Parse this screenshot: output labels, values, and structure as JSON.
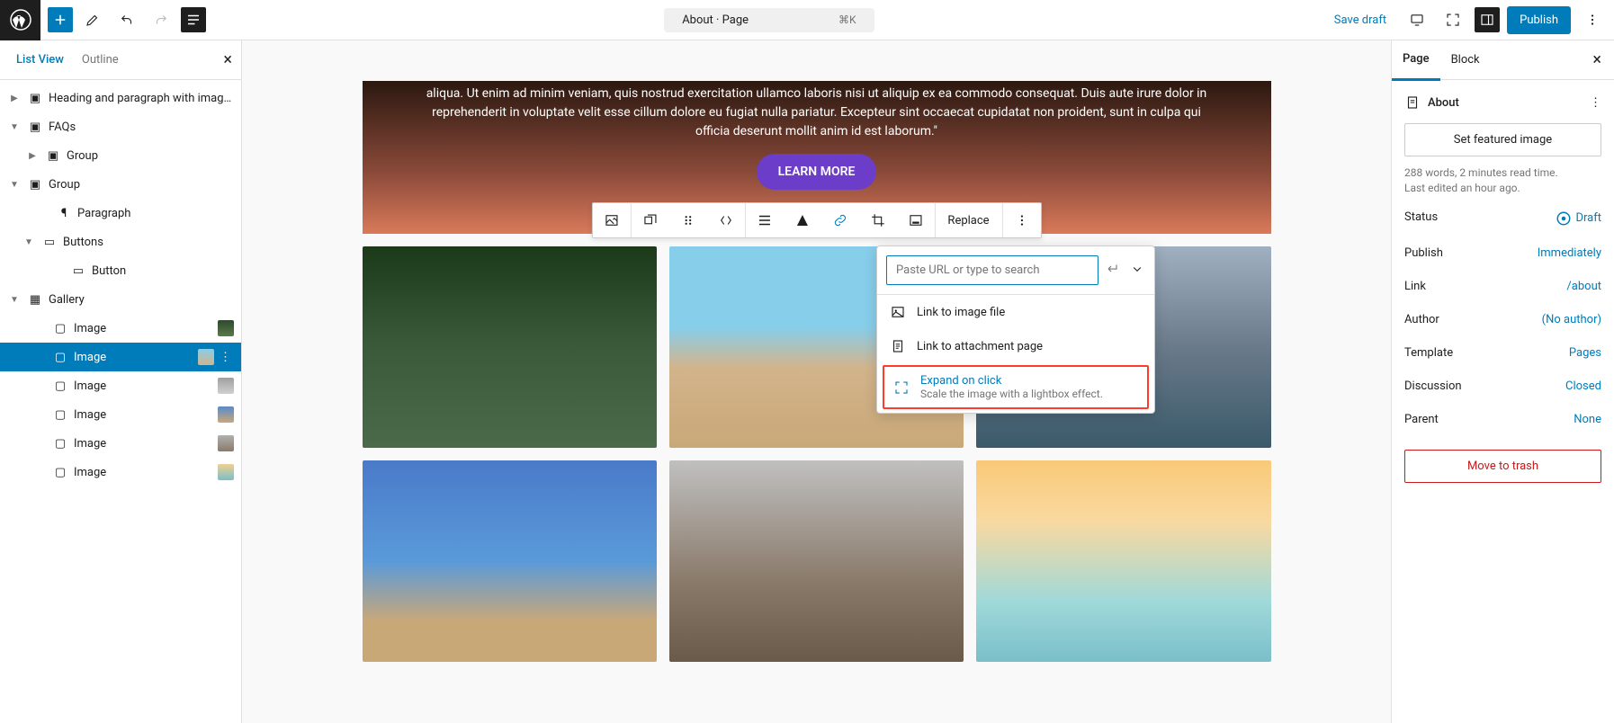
{
  "topbar": {
    "doc_title": "About · Page",
    "shortcut": "⌘K",
    "save_draft": "Save draft",
    "publish": "Publish"
  },
  "left_panel": {
    "tabs": {
      "list_view": "List View",
      "outline": "Outline"
    },
    "tree": {
      "heading_para": "Heading and paragraph with image on t…",
      "faqs": "FAQs",
      "group1": "Group",
      "group2": "Group",
      "paragraph": "Paragraph",
      "buttons": "Buttons",
      "button": "Button",
      "gallery": "Gallery",
      "image": "Image"
    }
  },
  "hero": {
    "text": "aliqua. Ut enim ad minim veniam, quis nostrud exercitation ullamco laboris nisi ut aliquip ex ea commodo consequat. Duis aute irure dolor in reprehenderit in voluptate velit esse cillum dolore eu fugiat nulla pariatur. Excepteur sint occaecat cupidatat non proident, sunt in culpa qui officia deserunt mollit anim id est laborum.\"",
    "button": "LEARN MORE"
  },
  "toolbar": {
    "replace": "Replace"
  },
  "link_popover": {
    "placeholder": "Paste URL or type to search",
    "opt1": "Link to image file",
    "opt2": "Link to attachment page",
    "opt3_title": "Expand on click",
    "opt3_sub": "Scale the image with a lightbox effect."
  },
  "right_panel": {
    "tabs": {
      "page": "Page",
      "block": "Block"
    },
    "title": "About",
    "featured": "Set featured image",
    "summary": "288 words, 2 minutes read time.\nLast edited an hour ago.",
    "rows": {
      "status_k": "Status",
      "status_v": "Draft",
      "publish_k": "Publish",
      "publish_v": "Immediately",
      "link_k": "Link",
      "link_v": "/about",
      "author_k": "Author",
      "author_v": "(No author)",
      "template_k": "Template",
      "template_v": "Pages",
      "discussion_k": "Discussion",
      "discussion_v": "Closed",
      "parent_k": "Parent",
      "parent_v": "None"
    },
    "trash": "Move to trash"
  }
}
